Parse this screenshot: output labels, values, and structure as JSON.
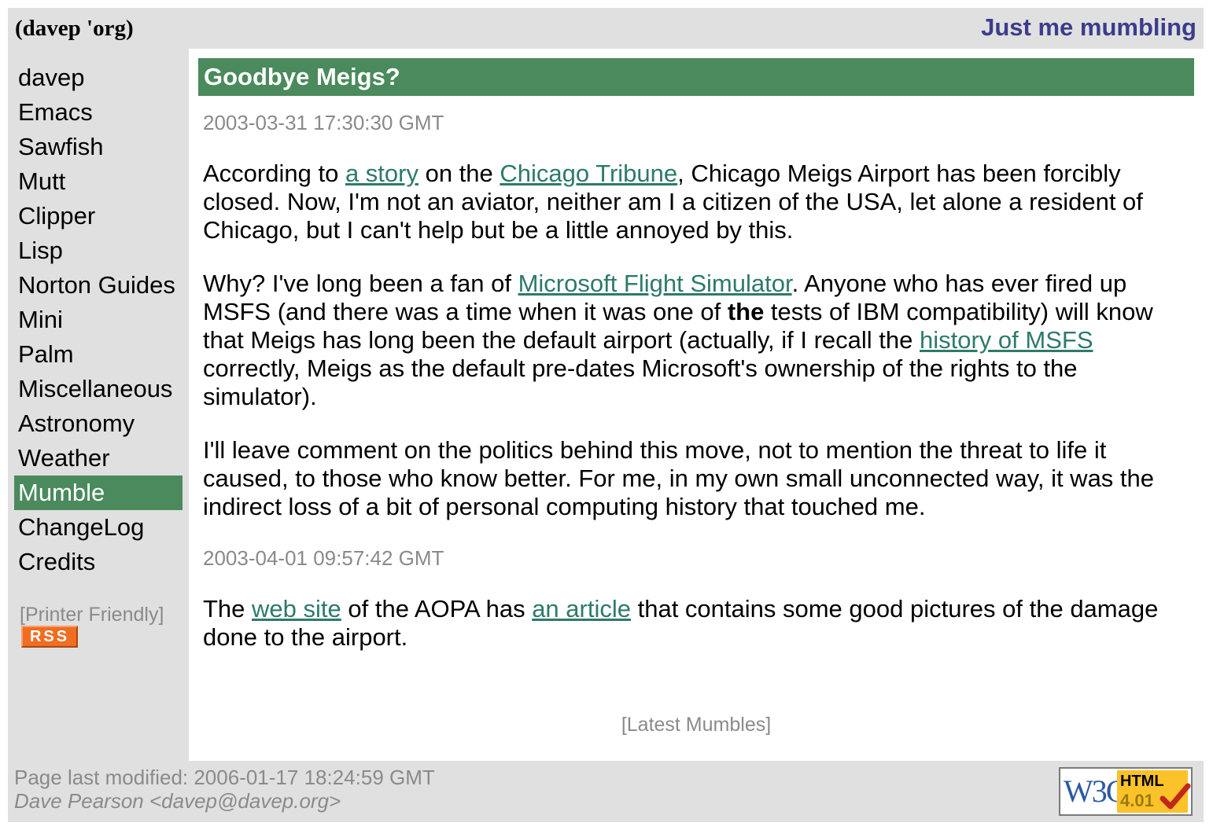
{
  "header": {
    "site_title": "(davep 'org)",
    "tagline": "Just me mumbling"
  },
  "sidebar": {
    "items": [
      {
        "label": "davep",
        "active": false
      },
      {
        "label": "Emacs",
        "active": false
      },
      {
        "label": "Sawfish",
        "active": false
      },
      {
        "label": "Mutt",
        "active": false
      },
      {
        "label": "Clipper",
        "active": false
      },
      {
        "label": "Lisp",
        "active": false
      },
      {
        "label": "Norton Guides",
        "active": false
      },
      {
        "label": "Mini",
        "active": false
      },
      {
        "label": "Palm",
        "active": false
      },
      {
        "label": "Miscellaneous",
        "active": false
      },
      {
        "label": "Astronomy",
        "active": false
      },
      {
        "label": "Weather",
        "active": false
      },
      {
        "label": "Mumble",
        "active": true
      },
      {
        "label": "ChangeLog",
        "active": false
      },
      {
        "label": "Credits",
        "active": false
      }
    ],
    "printer_friendly": "[Printer Friendly]",
    "rss_label": "RSS"
  },
  "post": {
    "title": "Goodbye Meigs?",
    "entries": [
      {
        "timestamp": "2003-03-31 17:30:30 GMT",
        "paragraphs": [
          [
            {
              "text": "According to "
            },
            {
              "text": "a story",
              "link": true
            },
            {
              "text": " on the "
            },
            {
              "text": "Chicago Tribune",
              "link": true
            },
            {
              "text": ", Chicago Meigs Airport has been forcibly closed. Now, I'm not an aviator, neither am I a citizen of the USA, let alone a resident of Chicago, but I can't help but be a little annoyed by this."
            }
          ],
          [
            {
              "text": "Why? I've long been a fan of "
            },
            {
              "text": "Microsoft Flight Simulator",
              "link": true
            },
            {
              "text": ". Anyone who has ever fired up MSFS (and there was a time when it was one of "
            },
            {
              "text": "the",
              "bold": true
            },
            {
              "text": " tests of IBM compatibility) will know that Meigs has long been the default airport (actually, if I recall the "
            },
            {
              "text": "history of MSFS",
              "link": true
            },
            {
              "text": " correctly, Meigs as the default pre-dates Microsoft's ownership of the rights to the simulator)."
            }
          ],
          [
            {
              "text": "I'll leave comment on the politics behind this move, not to mention the threat to life it caused, to those who know better. For me, in my own small unconnected way, it was the indirect loss of a bit of personal computing history that touched me."
            }
          ]
        ]
      },
      {
        "timestamp": "2003-04-01 09:57:42 GMT",
        "paragraphs": [
          [
            {
              "text": "The "
            },
            {
              "text": "web site",
              "link": true
            },
            {
              "text": " of the AOPA has "
            },
            {
              "text": "an article",
              "link": true
            },
            {
              "text": " that contains some good pictures of the damage done to the airport."
            }
          ]
        ]
      }
    ],
    "latest_link": "[Latest Mumbles]"
  },
  "footer": {
    "modified": "Page last modified: 2006-01-17 18:24:59 GMT",
    "author": "Dave Pearson <davep@davep.org>",
    "badge": {
      "logo": "W3C",
      "html": "HTML",
      "version": "4.01",
      "icon": "checkmark-icon"
    }
  },
  "colors": {
    "accent_green": "#4a8a5c",
    "tagline_purple": "#3c3c8c",
    "link": "#2e7a6a",
    "muted": "#8a8a8a",
    "chrome": "#e0e0e0"
  }
}
